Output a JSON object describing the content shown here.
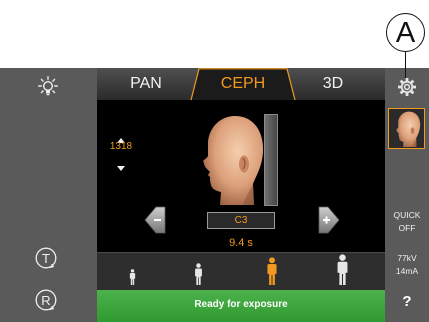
{
  "callout": {
    "label": "A"
  },
  "tabs": [
    {
      "label": "PAN",
      "selected": false
    },
    {
      "label": "CEPH",
      "selected": true
    },
    {
      "label": "3D",
      "selected": false
    }
  ],
  "left_panel": {
    "light_icon": "lightbulb-icon",
    "t_button": {
      "icon": "t-circle-icon",
      "label": "T"
    },
    "r_button": {
      "icon": "r-circle-icon",
      "label": "R"
    }
  },
  "height_control": {
    "value": "1318",
    "up_icon": "triangle-up-icon",
    "down_icon": "triangle-down-icon"
  },
  "vertebra_selector": {
    "value": "C3",
    "prev_icon": "minus-arrow-icon",
    "next_icon": "plus-arrow-icon"
  },
  "exposure_time": "9.4 s",
  "patient_sizes": [
    {
      "icon": "person-small-icon",
      "selected": false
    },
    {
      "icon": "person-medium-icon",
      "selected": false
    },
    {
      "icon": "person-large-icon",
      "selected": true
    },
    {
      "icon": "person-xlarge-icon",
      "selected": false
    }
  ],
  "right_panel": {
    "settings_icon": "gear-icon",
    "thumbnail_icon": "head-thumbnail-icon",
    "quick_line1": "QUICK",
    "quick_line2": "OFF",
    "kv": "77kV",
    "ma": "14mA",
    "help": "?"
  },
  "status": {
    "text": "Ready for exposure"
  },
  "colors": {
    "accent": "#f29a1f",
    "status_green": "#2f9a2f",
    "sidebar": "#5a5a5a",
    "viewport": "#000000"
  }
}
